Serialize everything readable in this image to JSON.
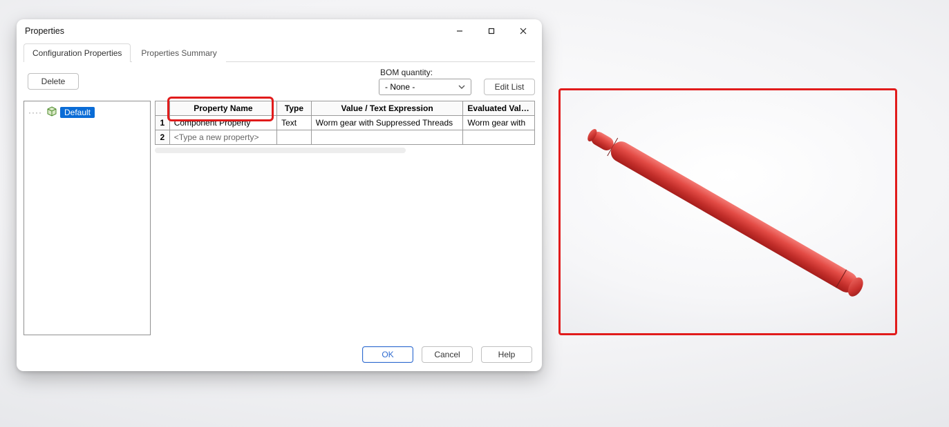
{
  "dialog": {
    "title": "Properties",
    "tabs": {
      "config": "Configuration Properties",
      "summary": "Properties Summary"
    },
    "delete_label": "Delete",
    "bom": {
      "label": "BOM quantity:",
      "selected": "- None -"
    },
    "edit_list_label": "Edit List",
    "tree": {
      "item": "Default"
    },
    "table": {
      "headers": {
        "name": "Property Name",
        "type": "Type",
        "value": "Value / Text Expression",
        "evaluated": "Evaluated Value"
      },
      "rows": [
        {
          "num": "1",
          "name": "Component Property",
          "type": "Text",
          "value": "Worm gear with Suppressed Threads",
          "evaluated": "Worm gear with"
        },
        {
          "num": "2",
          "name_placeholder": "<Type a new property>",
          "type": "",
          "value": "",
          "evaluated": ""
        }
      ]
    },
    "buttons": {
      "ok": "OK",
      "cancel": "Cancel",
      "help": "Help"
    }
  },
  "viewport": {
    "part_color": "#e34b45"
  }
}
